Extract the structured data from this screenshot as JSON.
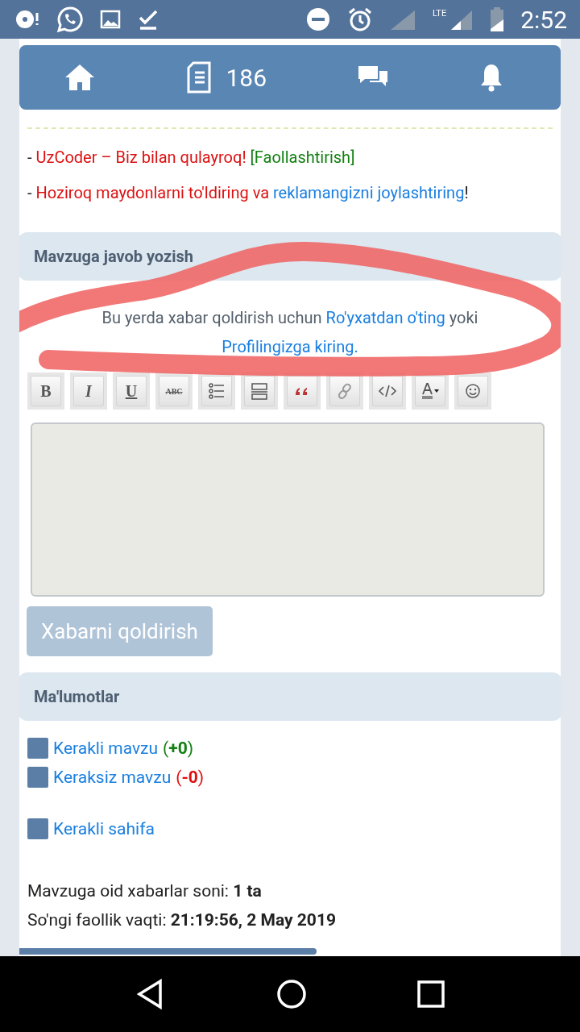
{
  "status_bar": {
    "network": "LTE",
    "time": "2:52"
  },
  "nav": {
    "count": "186"
  },
  "ads": [
    {
      "segments": [
        {
          "kind": "plain",
          "text": "- "
        },
        {
          "kind": "red",
          "text": "UzCoder – Biz bilan qulayroq! "
        },
        {
          "kind": "action",
          "text": "[Faollashtirish]"
        }
      ]
    },
    {
      "segments": [
        {
          "kind": "plain",
          "text": "- "
        },
        {
          "kind": "red",
          "text": "Hoziroq maydonlarni to'ldiring va "
        },
        {
          "kind": "link",
          "text": "reklamangizni joylashtiring"
        },
        {
          "kind": "plain",
          "text": "!"
        }
      ]
    }
  ],
  "reply": {
    "title": "Mavzuga javob yozish",
    "notice": [
      {
        "kind": "plain",
        "text": "Bu yerda xabar qoldirish uchun "
      },
      {
        "kind": "link",
        "text": "Ro'yxatdan o'ting"
      },
      {
        "kind": "plain",
        "text": " yoki "
      },
      {
        "kind": "link",
        "text": "Profilingizga kiring."
      }
    ],
    "toolbar": [
      {
        "kind": "bold",
        "label": "B"
      },
      {
        "kind": "italic",
        "label": "I"
      },
      {
        "kind": "underline",
        "label": "U"
      },
      {
        "kind": "strike",
        "label": "ABC"
      },
      {
        "kind": "list"
      },
      {
        "kind": "rule"
      },
      {
        "kind": "quote"
      },
      {
        "kind": "link"
      },
      {
        "kind": "code"
      },
      {
        "kind": "color"
      },
      {
        "kind": "smiley"
      }
    ],
    "submit": {
      "label": "Xabarni qoldirish",
      "disabled": true
    }
  },
  "info": {
    "title": "Ma'lumotlar",
    "votes": [
      {
        "label": "Kerakli mavzu",
        "count": "(**+0**)",
        "color": "#138013"
      },
      {
        "label": "Keraksiz mavzu",
        "count": "(**-0**)",
        "color": "#e01010"
      }
    ],
    "page_vote": {
      "label": "Kerakli sahifa"
    },
    "stats": [
      "Mavzuga oid xabarlar soni: **1 ta**",
      "So'ngi faollik vaqti: **21:19:56, 2 May 2019**"
    ]
  }
}
